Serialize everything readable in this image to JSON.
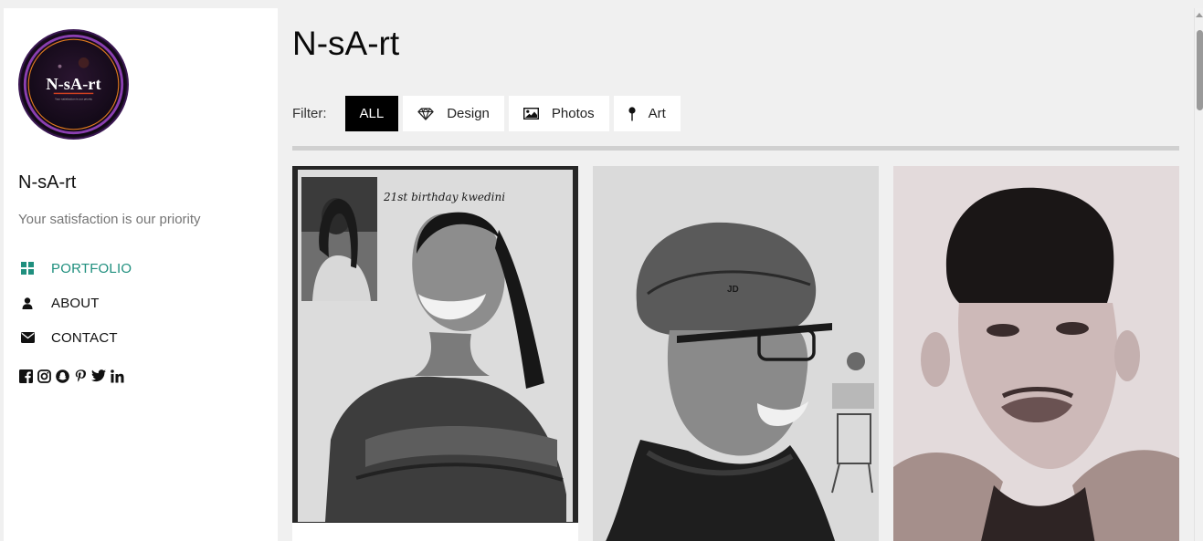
{
  "sidebar": {
    "logo": {
      "text": "N-sA-rt",
      "small_text": "Your satisfaction is our priority"
    },
    "brand_name": "N-sA-rt",
    "tagline": "Your satisfaction is our priority",
    "nav": [
      {
        "label": "PORTFOLIO",
        "icon": "grid-icon",
        "active": true
      },
      {
        "label": "ABOUT",
        "icon": "user-icon",
        "active": false
      },
      {
        "label": "CONTACT",
        "icon": "envelope-icon",
        "active": false
      }
    ],
    "social": [
      "facebook-icon",
      "instagram-icon",
      "snapchat-icon",
      "pinterest-icon",
      "twitter-icon",
      "linkedin-icon"
    ]
  },
  "main": {
    "title": "N-sA-rt",
    "filter": {
      "label": "Filter:",
      "buttons": [
        {
          "label": "ALL",
          "icon": "",
          "active": true
        },
        {
          "label": "Design",
          "icon": "diamond-icon",
          "active": false
        },
        {
          "label": "Photos",
          "icon": "image-icon",
          "active": false
        },
        {
          "label": "Art",
          "icon": "pin-icon",
          "active": false
        }
      ]
    },
    "gallery": [
      {
        "caption_text": "21st birthday kwedini"
      },
      {
        "caption_text": "JD"
      },
      {
        "caption_text": ""
      }
    ]
  },
  "colors": {
    "accent": "#1f8f7e",
    "background": "#f0f0f0",
    "sidebar": "#ffffff",
    "active_filter": "#000000"
  }
}
